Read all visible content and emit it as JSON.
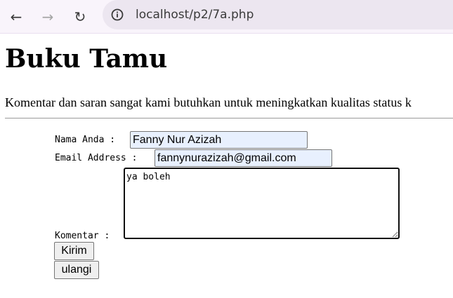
{
  "browser": {
    "back_icon": "←",
    "forward_icon": "→",
    "reload_icon": "↻",
    "url": "localhost/p2/7a.php"
  },
  "page": {
    "title": "Buku Tamu",
    "intro": "Komentar dan saran sangat kami butuhkan untuk meningkatkan kualitas status k"
  },
  "form": {
    "nama_label": "Nama Anda : ",
    "nama_value": "Fanny Nur Azizah",
    "email_label": "Email Address : ",
    "email_value": "fannynurazizah@gmail.com",
    "komentar_label": "Komentar : ",
    "komentar_value": "ya boleh",
    "submit_label": "Kirim",
    "reset_label": "ulangi"
  }
}
